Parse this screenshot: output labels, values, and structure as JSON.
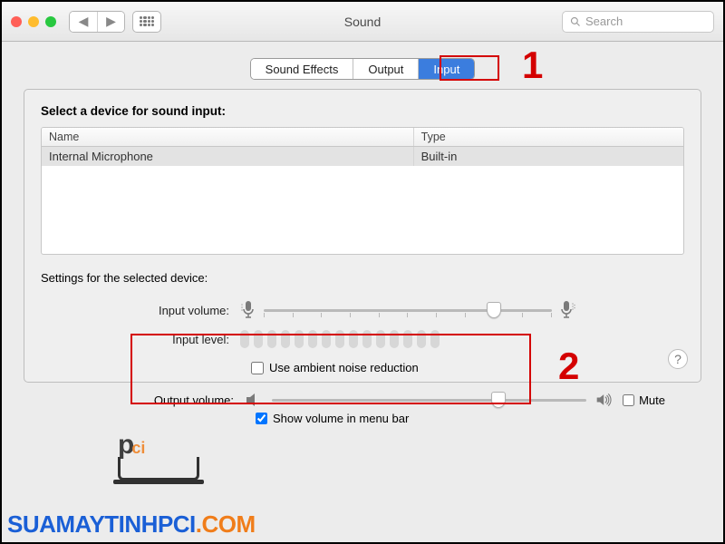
{
  "window": {
    "title": "Sound"
  },
  "search": {
    "placeholder": "Search"
  },
  "tabs": [
    {
      "id": "sound-effects",
      "label": "Sound Effects",
      "selected": false
    },
    {
      "id": "output",
      "label": "Output",
      "selected": false
    },
    {
      "id": "input",
      "label": "Input",
      "selected": true
    }
  ],
  "panel": {
    "select_label": "Select a device for sound input:",
    "columns": {
      "name": "Name",
      "type": "Type"
    },
    "devices": [
      {
        "name": "Internal Microphone",
        "type": "Built-in"
      }
    ],
    "settings_label": "Settings for the selected device:",
    "input_volume_label": "Input volume:",
    "input_volume_percent": 80,
    "input_level_label": "Input level:",
    "noise_reduction_label": "Use ambient noise reduction",
    "noise_reduction_checked": false
  },
  "output": {
    "volume_label": "Output volume:",
    "volume_percent": 72,
    "mute_label": "Mute",
    "mute_checked": false,
    "menubar_label": "Show volume in menu bar",
    "menubar_checked": true
  },
  "annotations": {
    "one": "1",
    "two": "2"
  },
  "watermark": {
    "text_a": "SUAMAYTINHPCI",
    "text_b": ".COM",
    "logo_p": "p",
    "logo_ci": "ci"
  }
}
